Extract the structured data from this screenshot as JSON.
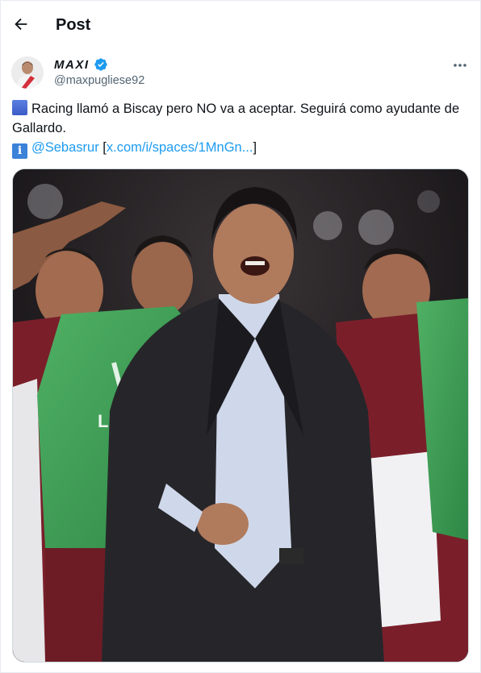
{
  "header": {
    "title": "Post",
    "back_icon": "arrow-left-icon"
  },
  "author": {
    "display_name": "MAXI",
    "handle": "@maxpugliese92",
    "verified": true,
    "verified_color": "#1d9bf0",
    "avatar_icon": "avatar-image"
  },
  "menu": {
    "icon": "more-horizontal-icon"
  },
  "tweet": {
    "line1_text": "Racing llamó a Biscay pero NO va a aceptar. Seguirá como ayudante de Gallardo.",
    "mention": "@Sebasrur",
    "link_open": "[",
    "link": "x.com/i/spaces/1MnGn...",
    "link_close": "]",
    "emoji1": "blue-square-emoji",
    "emoji2": "information-emoji"
  },
  "media": {
    "type": "photo",
    "description_icon": "tweet-photo"
  },
  "colors": {
    "accent": "#1d9bf0",
    "text": "#0f1419",
    "secondary": "#536471",
    "border": "#cfd9de"
  }
}
